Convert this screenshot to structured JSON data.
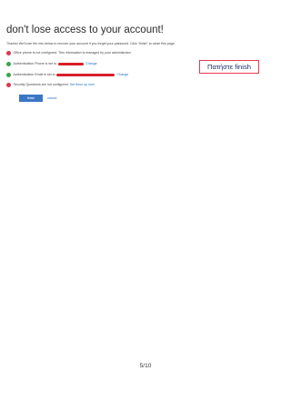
{
  "dialog": {
    "title": "don't lose access to your account!",
    "intro": "Thanks! We'll use the info below to recover your account if you forget your password. Click \"finish\" to close this page.",
    "items": [
      {
        "status": "error",
        "text": "Office phone is not configured. This information is managed by your administrator.",
        "link": ""
      },
      {
        "status": "ok",
        "text_before": "Authentication Phone is set to",
        "link": "Change"
      },
      {
        "status": "ok",
        "text_before": "Authentication Email is set to",
        "link": "Change"
      },
      {
        "status": "error",
        "text": "Security Questions are not configured.",
        "link": "Set them up now"
      }
    ],
    "finish_label": "finish",
    "cancel_label": "cancel"
  },
  "annotation": {
    "callout_text": "Πατήστε finish",
    "callout_border_color": "#e8394e"
  },
  "footer": {
    "page_number": "5/10"
  },
  "colors": {
    "accent": "#3b76c4",
    "link": "#1d6fbf",
    "error": "#d9364e",
    "success": "#3aa64c",
    "redaction": "#d81f2a"
  }
}
